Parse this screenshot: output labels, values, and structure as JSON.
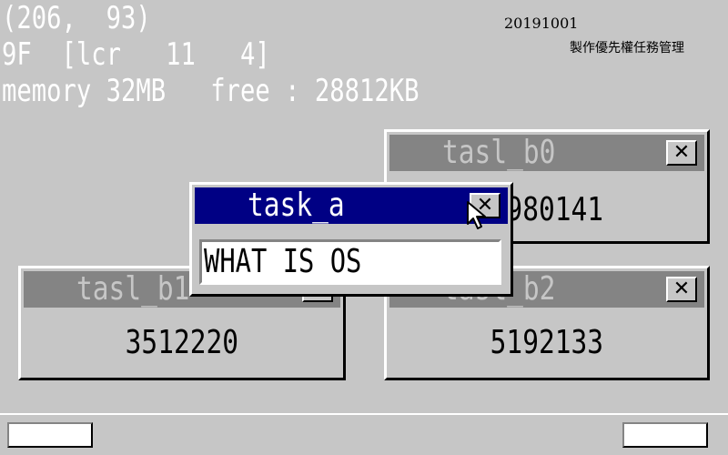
{
  "status": {
    "mouse_coords": "(206,  93)",
    "key_info": "9F  [lcr   11   4]",
    "memory_info": "memory 32MB   free : 28812KB"
  },
  "header": {
    "date": "20191001",
    "subtitle": "製作優先權任務管理"
  },
  "windows": {
    "task_b0": {
      "title": "tasl_b0",
      "counter": "1980141",
      "close_label": "✕"
    },
    "task_b1": {
      "title": "tasl_b1",
      "counter": "3512220",
      "close_label": "✕"
    },
    "task_b2": {
      "title": "tasl_b2",
      "counter": "5192133",
      "close_label": "✕"
    },
    "task_a": {
      "title": "task_a",
      "input_value": "WHAT IS OS",
      "close_label": "✕"
    }
  },
  "taskbar": {
    "left_button": "",
    "right_button": ""
  },
  "colors": {
    "desktop": "#c6c6c6",
    "active_title": "#000084",
    "inactive_title": "#848484",
    "text_white": "#ffffff"
  },
  "icons": {
    "close": "close-icon",
    "pointer": "mouse-pointer-icon"
  }
}
